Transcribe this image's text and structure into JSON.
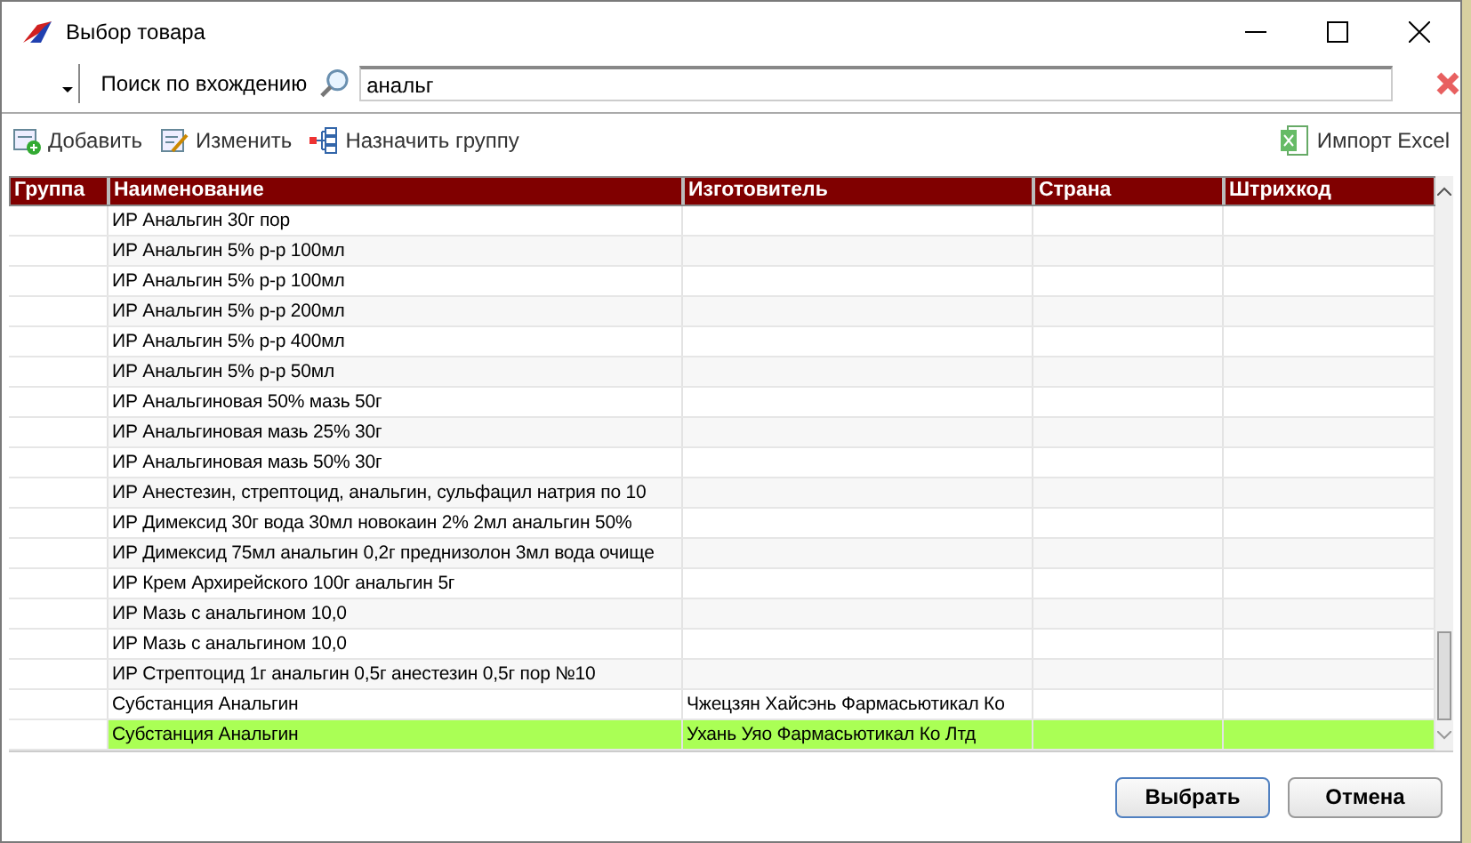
{
  "window": {
    "title": "Выбор товара"
  },
  "search": {
    "mode_label": "Поиск по вхождению",
    "value": "анальг"
  },
  "toolbar": {
    "buttons": [
      {
        "kind": "add",
        "label": "Добавить"
      },
      {
        "kind": "edit",
        "label": "Изменить"
      },
      {
        "kind": "group",
        "label": "Назначить группу"
      }
    ],
    "import_button": "Импорт Excel"
  },
  "table": {
    "columns": [
      "Группа",
      "Наименование",
      "Изготовитель",
      "Страна",
      "Штрихкод"
    ],
    "rows": [
      {
        "name": "ИР Анальгин 30г пор",
        "selected": false
      },
      {
        "name": "ИР Анальгин 5% р-р 100мл",
        "selected": false
      },
      {
        "name": "ИР Анальгин 5% р-р 100мл",
        "selected": false
      },
      {
        "name": "ИР Анальгин 5% р-р 200мл",
        "selected": false
      },
      {
        "name": "ИР Анальгин 5% р-р 400мл",
        "selected": false
      },
      {
        "name": "ИР Анальгин 5% р-р 50мл",
        "selected": false
      },
      {
        "name": "ИР Анальгиновая 50% мазь 50г",
        "selected": false
      },
      {
        "name": "ИР Анальгиновая мазь 25% 30г",
        "selected": false
      },
      {
        "name": "ИР Анальгиновая мазь 50% 30г",
        "selected": false
      },
      {
        "name": "ИР Анестезин, стрептоцид, анальгин, сульфацил натрия по 10",
        "selected": false
      },
      {
        "name": "ИР Димексид 30г вода 30мл новокаин 2% 2мл анальгин 50%",
        "selected": false
      },
      {
        "name": "ИР Димексид 75мл анальгин 0,2г преднизолон 3мл вода очище",
        "selected": false
      },
      {
        "name": "ИР Крем Архирейского 100г анальгин 5г",
        "selected": false
      },
      {
        "name": "ИР Мазь с анальгином 10,0",
        "selected": false
      },
      {
        "name": "ИР Мазь с анальгином 10,0",
        "selected": false
      },
      {
        "name": "ИР Стрептоцид 1г анальгин 0,5г анестезин 0,5г пор №10",
        "selected": false
      },
      {
        "name": "Субстанция Анальгин",
        "maker": "Чжецзян Хайсэнь Фармасьютикал Ко",
        "selected": false
      },
      {
        "name": "Субстанция Анальгин",
        "maker": "Ухань Уяо Фармасьютикал Ко Лтд",
        "selected": true
      }
    ]
  },
  "buttons": [
    {
      "label": "Выбрать",
      "default": true
    },
    {
      "label": "Отмена",
      "default": false
    }
  ]
}
